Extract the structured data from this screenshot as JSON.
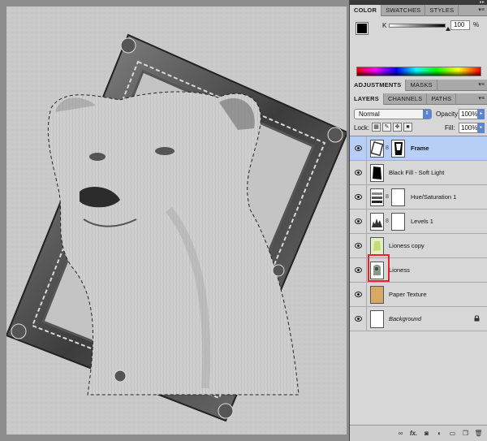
{
  "color_panel": {
    "tabs": [
      "COLOR",
      "SWATCHES",
      "STYLES"
    ],
    "active_tab": "COLOR",
    "channel_label": "K",
    "channel_value": "100",
    "percent_sign": "%",
    "foreground": "#000000",
    "background": "#ffffff"
  },
  "adjustments_panel": {
    "tabs": [
      "ADJUSTMENTS",
      "MASKS"
    ],
    "active_tab": "ADJUSTMENTS"
  },
  "layers_panel": {
    "tabs": [
      "LAYERS",
      "CHANNELS",
      "PATHS"
    ],
    "active_tab": "LAYERS",
    "blend_mode": "Normal",
    "opacity_label": "Opacity:",
    "opacity_value": "100%",
    "lock_label": "Lock:",
    "fill_label": "Fill:",
    "fill_value": "100%",
    "layers": [
      {
        "name": "Frame",
        "selected": true,
        "bold": true
      },
      {
        "name": "Black Fill - Soft Light",
        "selected": false
      },
      {
        "name": "Hue/Saturation 1",
        "selected": false
      },
      {
        "name": "Levels 1",
        "selected": false
      },
      {
        "name": "Lioness copy",
        "selected": false
      },
      {
        "name": "Lioness",
        "selected": false,
        "highlighted": true
      },
      {
        "name": "Paper Texture",
        "selected": false
      },
      {
        "name": "Background",
        "selected": false,
        "italic": true,
        "locked": true
      }
    ]
  },
  "icons": {
    "panel_menu": "panel-menu-icon",
    "visibility": "eye-icon",
    "link": "chain-link-icon",
    "lock": "lock-icon"
  },
  "colors": {
    "selection_highlight": "#b7cff7",
    "annotation_box": "#e22222",
    "accent_blue": "#5a82d8"
  }
}
